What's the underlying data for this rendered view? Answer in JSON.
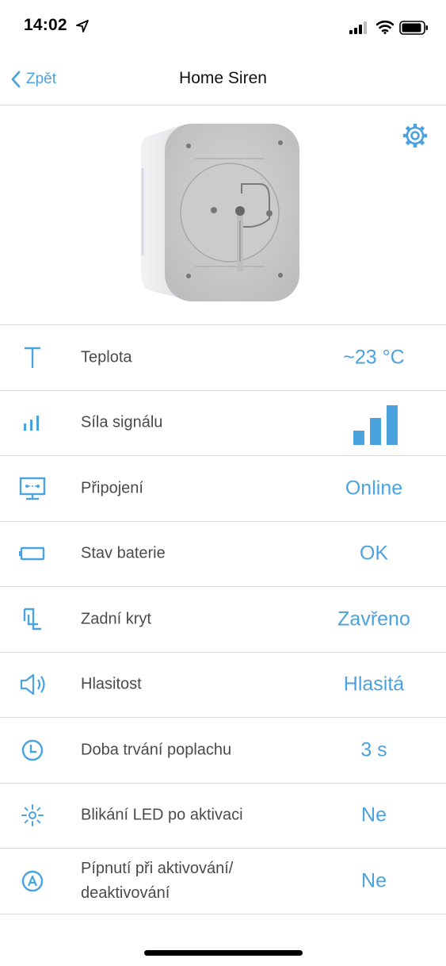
{
  "status_bar": {
    "time": "14:02"
  },
  "nav": {
    "back_label": "Zpět",
    "title": "Home Siren"
  },
  "rows": [
    {
      "label": "Teplota",
      "value": "~23 °C",
      "icon": "thermometer-t-icon"
    },
    {
      "label": "Síla signálu",
      "value": "",
      "signal_level": 3,
      "signal_max": 3,
      "icon": "signal-bars-icon"
    },
    {
      "label": "Připojení",
      "value": "Online",
      "icon": "connection-monitor-icon"
    },
    {
      "label": "Stav baterie",
      "value": "OK",
      "icon": "battery-icon"
    },
    {
      "label": "Zadní kryt",
      "value": "Zavřeno",
      "icon": "lid-icon"
    },
    {
      "label": "Hlasitost",
      "value": "Hlasitá",
      "icon": "speaker-icon"
    },
    {
      "label": "Doba trvání poplachu",
      "value": "3 s",
      "icon": "clock-icon"
    },
    {
      "label": "Blikání LED po aktivaci",
      "value": "Ne",
      "icon": "led-flash-icon"
    },
    {
      "label": "Pípnutí při aktivování/ deaktivování",
      "value": "Ne",
      "icon": "arming-beep-icon"
    }
  ],
  "colors": {
    "accent": "#4aa3df",
    "divider": "#dcdcdc",
    "label": "#4a4a4a"
  }
}
